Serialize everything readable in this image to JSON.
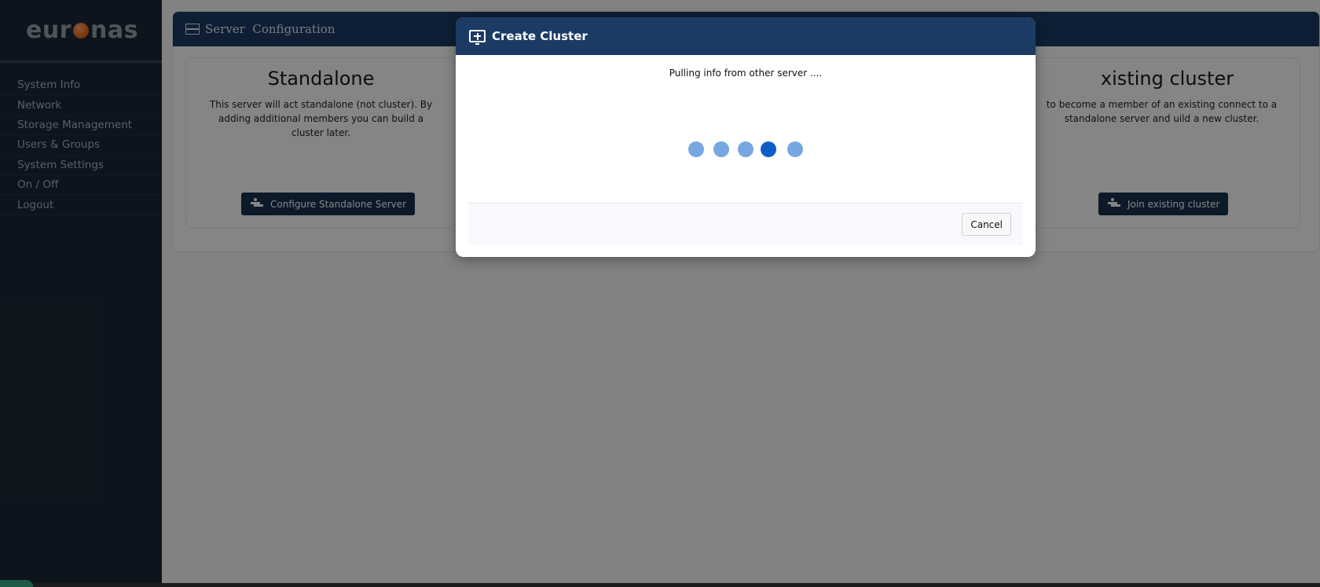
{
  "brand": {
    "prefix": "eur",
    "suffix": "nas"
  },
  "sidebar": {
    "items": [
      {
        "label": "System Info"
      },
      {
        "label": "Network"
      },
      {
        "label": "Storage Management"
      },
      {
        "label": "Users & Groups"
      },
      {
        "label": "System Settings"
      },
      {
        "label": "On / Off"
      },
      {
        "label": "Logout"
      }
    ]
  },
  "panel": {
    "title": "Server  Configuration",
    "cards": [
      {
        "title": "Standalone",
        "description": "This server will act standalone (not cluster). By adding additional members you can build a cluster later.",
        "button": "Configure Standalone Server"
      },
      {
        "title": "xisting cluster",
        "description": "to become a member of an existing connect to a standalone server and uild a new cluster.",
        "button": "Join existing cluster"
      }
    ]
  },
  "modal": {
    "title": "Create Cluster",
    "message": "Pulling info from other server ....",
    "loader": {
      "dots": 5,
      "active_index": 3
    },
    "cancel_label": "Cancel"
  },
  "colors": {
    "header": "#1b3b64",
    "sidebar": "#1c2838",
    "loader_dot": "#77a7e0",
    "loader_active": "#0f5ec8",
    "brand_orange": "#f07020"
  }
}
